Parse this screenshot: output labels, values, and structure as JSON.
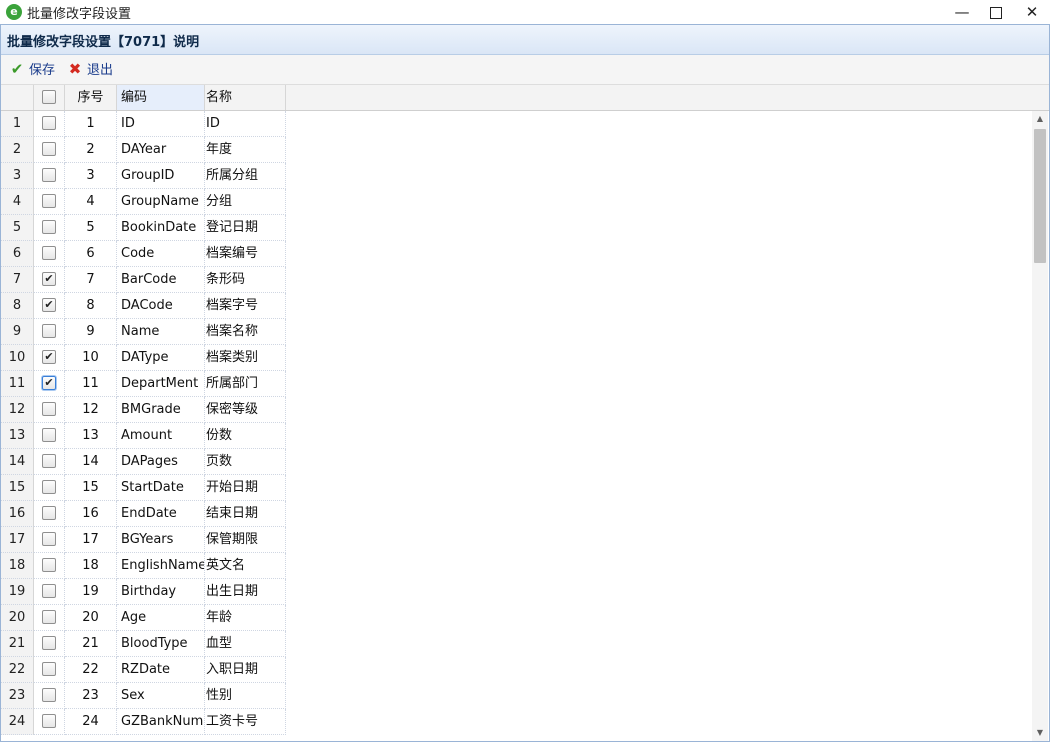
{
  "window": {
    "title": "批量修改字段设置",
    "app_icon": "e",
    "min_icon": "—",
    "close_icon": "✕"
  },
  "panel": {
    "title": "批量修改字段设置【7071】说明"
  },
  "toolbar": {
    "save_label": "保存",
    "exit_label": "退出",
    "save_icon": "✔",
    "exit_icon": "✖"
  },
  "grid": {
    "headers": {
      "row_num": "",
      "checkbox": "",
      "seq": "序号",
      "code": "编码",
      "name": "名称"
    },
    "rows": [
      {
        "rn": "1",
        "seq": "1",
        "code": "ID",
        "name": "ID",
        "checked": false
      },
      {
        "rn": "2",
        "seq": "2",
        "code": "DAYear",
        "name": "年度",
        "checked": false
      },
      {
        "rn": "3",
        "seq": "3",
        "code": "GroupID",
        "name": "所属分组",
        "checked": false
      },
      {
        "rn": "4",
        "seq": "4",
        "code": "GroupName",
        "name": "分组",
        "checked": false
      },
      {
        "rn": "5",
        "seq": "5",
        "code": "BookinDate",
        "name": "登记日期",
        "checked": false
      },
      {
        "rn": "6",
        "seq": "6",
        "code": "Code",
        "name": "档案编号",
        "checked": false
      },
      {
        "rn": "7",
        "seq": "7",
        "code": "BarCode",
        "name": "条形码",
        "checked": true
      },
      {
        "rn": "8",
        "seq": "8",
        "code": "DACode",
        "name": "档案字号",
        "checked": true
      },
      {
        "rn": "9",
        "seq": "9",
        "code": "Name",
        "name": "档案名称",
        "checked": false
      },
      {
        "rn": "10",
        "seq": "10",
        "code": "DAType",
        "name": "档案类别",
        "checked": true
      },
      {
        "rn": "11",
        "seq": "11",
        "code": "DepartMent",
        "name": "所属部门",
        "checked": true
      },
      {
        "rn": "12",
        "seq": "12",
        "code": "BMGrade",
        "name": "保密等级",
        "checked": false
      },
      {
        "rn": "13",
        "seq": "13",
        "code": "Amount",
        "name": "份数",
        "checked": false
      },
      {
        "rn": "14",
        "seq": "14",
        "code": "DAPages",
        "name": "页数",
        "checked": false
      },
      {
        "rn": "15",
        "seq": "15",
        "code": "StartDate",
        "name": "开始日期",
        "checked": false
      },
      {
        "rn": "16",
        "seq": "16",
        "code": "EndDate",
        "name": "结束日期",
        "checked": false
      },
      {
        "rn": "17",
        "seq": "17",
        "code": "BGYears",
        "name": "保管期限",
        "checked": false
      },
      {
        "rn": "18",
        "seq": "18",
        "code": "EnglishName",
        "name": "英文名",
        "checked": false
      },
      {
        "rn": "19",
        "seq": "19",
        "code": "Birthday",
        "name": "出生日期",
        "checked": false
      },
      {
        "rn": "20",
        "seq": "20",
        "code": "Age",
        "name": "年龄",
        "checked": false
      },
      {
        "rn": "21",
        "seq": "21",
        "code": "BloodType",
        "name": "血型",
        "checked": false
      },
      {
        "rn": "22",
        "seq": "22",
        "code": "RZDate",
        "name": "入职日期",
        "checked": false
      },
      {
        "rn": "23",
        "seq": "23",
        "code": "Sex",
        "name": "性别",
        "checked": false
      },
      {
        "rn": "24",
        "seq": "24",
        "code": "GZBankNuml",
        "name": "工资卡号",
        "checked": false
      }
    ]
  },
  "scrollbar": {
    "up_icon": "▲",
    "down_icon": "▼"
  }
}
